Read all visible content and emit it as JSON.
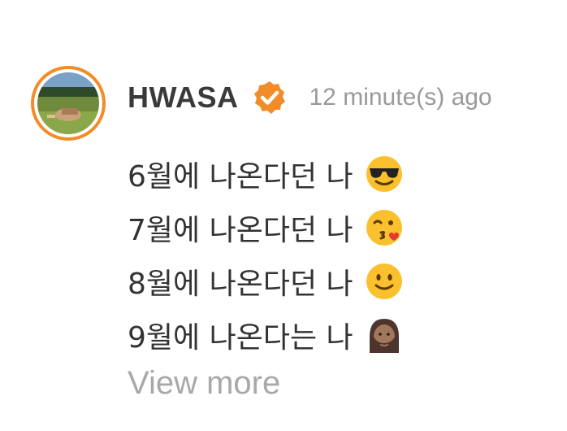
{
  "post": {
    "author": {
      "name": "HWASA",
      "verified_badge": "verified-check-icon",
      "accent_color": "#f28c28"
    },
    "timestamp": "12 minute(s) ago",
    "lines": [
      {
        "text": "6월에 나온다던 나",
        "emoji": "sunglasses-face-icon"
      },
      {
        "text": "7월에 나온다던 나",
        "emoji": "face-blowing-kiss-icon"
      },
      {
        "text": "8월에 나온다던 나",
        "emoji": "slightly-smiling-face-icon"
      },
      {
        "text": "9월에 나온다는 나",
        "emoji": "bearded-person-icon"
      }
    ],
    "view_more_label": "View more"
  }
}
